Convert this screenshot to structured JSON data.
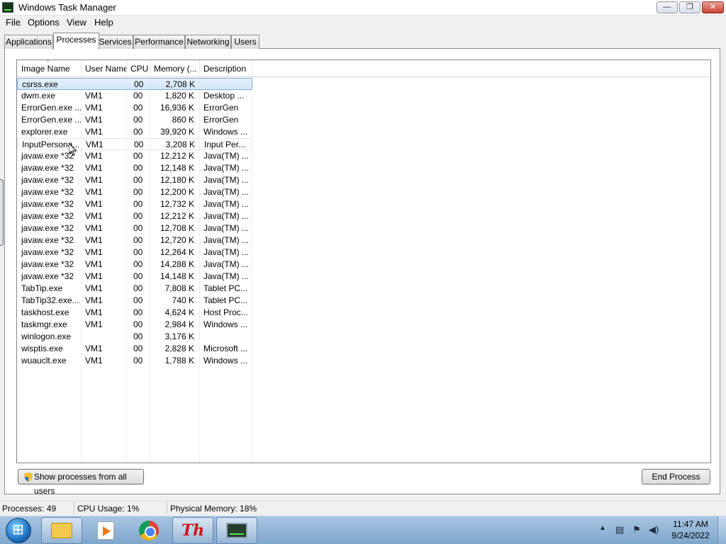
{
  "window": {
    "title": "Windows Task Manager",
    "controls": {
      "minimize": "—",
      "maximize": "❐",
      "close": "✕"
    }
  },
  "menu": [
    "File",
    "Options",
    "View",
    "Help"
  ],
  "tabs": [
    {
      "label": "Applications",
      "active": false
    },
    {
      "label": "Processes",
      "active": true
    },
    {
      "label": "Services",
      "active": false
    },
    {
      "label": "Performance",
      "active": false
    },
    {
      "label": "Networking",
      "active": false
    },
    {
      "label": "Users",
      "active": false
    }
  ],
  "table": {
    "columns": [
      "Image Name",
      "User Name",
      "CPU",
      "Memory (...",
      "Description"
    ],
    "sort_indicator": "^",
    "rows": [
      {
        "name": "csrss.exe",
        "user": "",
        "cpu": "00",
        "memory": "2,708 K",
        "description": "",
        "state": "selected"
      },
      {
        "name": "dwm.exe",
        "user": "VM1",
        "cpu": "00",
        "memory": "1,820 K",
        "description": "Desktop ..."
      },
      {
        "name": "ErrorGen.exe ...",
        "user": "VM1",
        "cpu": "00",
        "memory": "16,936 K",
        "description": "ErrorGen"
      },
      {
        "name": "ErrorGen.exe ...",
        "user": "VM1",
        "cpu": "00",
        "memory": "860 K",
        "description": "ErrorGen"
      },
      {
        "name": "explorer.exe",
        "user": "VM1",
        "cpu": "00",
        "memory": "39,920 K",
        "description": "Windows ..."
      },
      {
        "name": "InputPersona...",
        "user": "VM1",
        "cpu": "00",
        "memory": "3,208 K",
        "description": "Input Per...",
        "state": "hover"
      },
      {
        "name": "javaw.exe *32",
        "user": "VM1",
        "cpu": "00",
        "memory": "12,212 K",
        "description": "Java(TM) ..."
      },
      {
        "name": "javaw.exe *32",
        "user": "VM1",
        "cpu": "00",
        "memory": "12,148 K",
        "description": "Java(TM) ..."
      },
      {
        "name": "javaw.exe *32",
        "user": "VM1",
        "cpu": "00",
        "memory": "12,180 K",
        "description": "Java(TM) ..."
      },
      {
        "name": "javaw.exe *32",
        "user": "VM1",
        "cpu": "00",
        "memory": "12,200 K",
        "description": "Java(TM) ..."
      },
      {
        "name": "javaw.exe *32",
        "user": "VM1",
        "cpu": "00",
        "memory": "12,732 K",
        "description": "Java(TM) ..."
      },
      {
        "name": "javaw.exe *32",
        "user": "VM1",
        "cpu": "00",
        "memory": "12,212 K",
        "description": "Java(TM) ..."
      },
      {
        "name": "javaw.exe *32",
        "user": "VM1",
        "cpu": "00",
        "memory": "12,708 K",
        "description": "Java(TM) ..."
      },
      {
        "name": "javaw.exe *32",
        "user": "VM1",
        "cpu": "00",
        "memory": "12,720 K",
        "description": "Java(TM) ..."
      },
      {
        "name": "javaw.exe *32",
        "user": "VM1",
        "cpu": "00",
        "memory": "12,264 K",
        "description": "Java(TM) ..."
      },
      {
        "name": "javaw.exe *32",
        "user": "VM1",
        "cpu": "00",
        "memory": "14,288 K",
        "description": "Java(TM) ..."
      },
      {
        "name": "javaw.exe *32",
        "user": "VM1",
        "cpu": "00",
        "memory": "14,148 K",
        "description": "Java(TM) ..."
      },
      {
        "name": "TabTip.exe",
        "user": "VM1",
        "cpu": "00",
        "memory": "7,808 K",
        "description": "Tablet PC..."
      },
      {
        "name": "TabTip32.exe...",
        "user": "VM1",
        "cpu": "00",
        "memory": "740 K",
        "description": "Tablet PC..."
      },
      {
        "name": "taskhost.exe",
        "user": "VM1",
        "cpu": "00",
        "memory": "4,624 K",
        "description": "Host Proc..."
      },
      {
        "name": "taskmgr.exe",
        "user": "VM1",
        "cpu": "00",
        "memory": "2,984 K",
        "description": "Windows ..."
      },
      {
        "name": "winlogon.exe",
        "user": "",
        "cpu": "00",
        "memory": "3,176 K",
        "description": ""
      },
      {
        "name": "wisptis.exe",
        "user": "VM1",
        "cpu": "00",
        "memory": "2,828 K",
        "description": "Microsoft ..."
      },
      {
        "name": "wuauclt.exe",
        "user": "VM1",
        "cpu": "00",
        "memory": "1,788 K",
        "description": "Windows ..."
      }
    ]
  },
  "buttons": {
    "show_all": "Show processes from all users",
    "end_process": "End Process"
  },
  "status": {
    "processes": "Processes: 49",
    "cpu": "CPU Usage: 1%",
    "memory": "Physical Memory: 18%"
  },
  "taskbar": {
    "apps": [
      {
        "icon": "file-explorer-icon",
        "framed": true
      },
      {
        "icon": "media-player-icon",
        "framed": false
      },
      {
        "icon": "chrome-icon",
        "framed": false
      },
      {
        "icon": "th-app-icon",
        "label": "Th",
        "framed": true
      },
      {
        "icon": "task-manager-icon",
        "framed": true
      }
    ],
    "tray_icons": [
      "show-hidden-icons-arrow",
      "network-icon",
      "action-center-icon",
      "volume-icon"
    ],
    "time": "11:47 AM",
    "date": "9/24/2022"
  },
  "colors": {
    "selection_bg": "#d4e7f8",
    "selection_border": "#84acdd",
    "taskbar": "#8fb1d4",
    "close_button": "#c84030"
  }
}
